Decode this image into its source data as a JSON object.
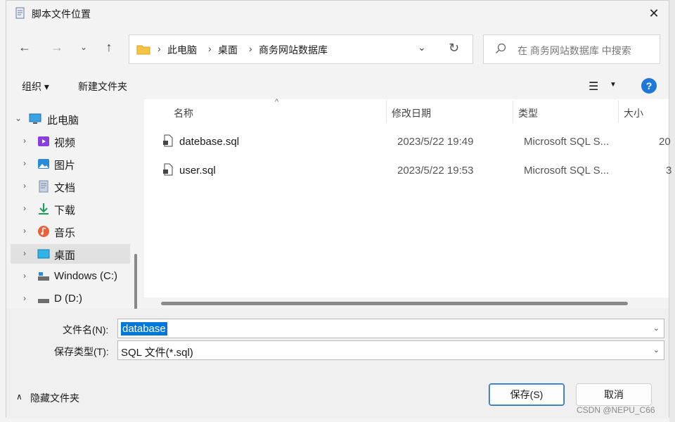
{
  "window": {
    "title": "脚本文件位置"
  },
  "address": {
    "crumbs": [
      "此电脑",
      "桌面",
      "商务网站数据库"
    ]
  },
  "search": {
    "placeholder": "在 商务网站数据库 中搜索"
  },
  "toolbar": {
    "organize": "组织 ▾",
    "new_folder": "新建文件夹"
  },
  "sidebar": {
    "items": [
      {
        "label": "此电脑",
        "icon": "monitor-icon",
        "expanded": true
      },
      {
        "label": "视频",
        "icon": "video-icon"
      },
      {
        "label": "图片",
        "icon": "picture-icon"
      },
      {
        "label": "文档",
        "icon": "document-icon"
      },
      {
        "label": "下载",
        "icon": "download-icon"
      },
      {
        "label": "音乐",
        "icon": "music-icon"
      },
      {
        "label": "桌面",
        "icon": "desktop-icon",
        "selected": true
      },
      {
        "label": "Windows (C:)",
        "icon": "drive-c-icon"
      },
      {
        "label": "D (D:)",
        "icon": "drive-d-icon"
      }
    ]
  },
  "columns": {
    "name": "名称",
    "modified": "修改日期",
    "type": "类型",
    "size": "大小"
  },
  "files": [
    {
      "name": "datebase.sql",
      "modified": "2023/5/22 19:49",
      "type": "Microsoft SQL S...",
      "size": "20"
    },
    {
      "name": "user.sql",
      "modified": "2023/5/22 19:53",
      "type": "Microsoft SQL S...",
      "size": "3"
    }
  ],
  "form": {
    "filename_label": "文件名(N):",
    "filename_value": "database",
    "filetype_label": "保存类型(T):",
    "filetype_value": "SQL 文件(*.sql)"
  },
  "footer": {
    "hide_folders": "隐藏文件夹",
    "save": "保存(S)",
    "cancel": "取消"
  },
  "watermark": "CSDN @NEPU_C66",
  "colors": {
    "accent": "#0078d7",
    "help": "#1e78d7"
  }
}
